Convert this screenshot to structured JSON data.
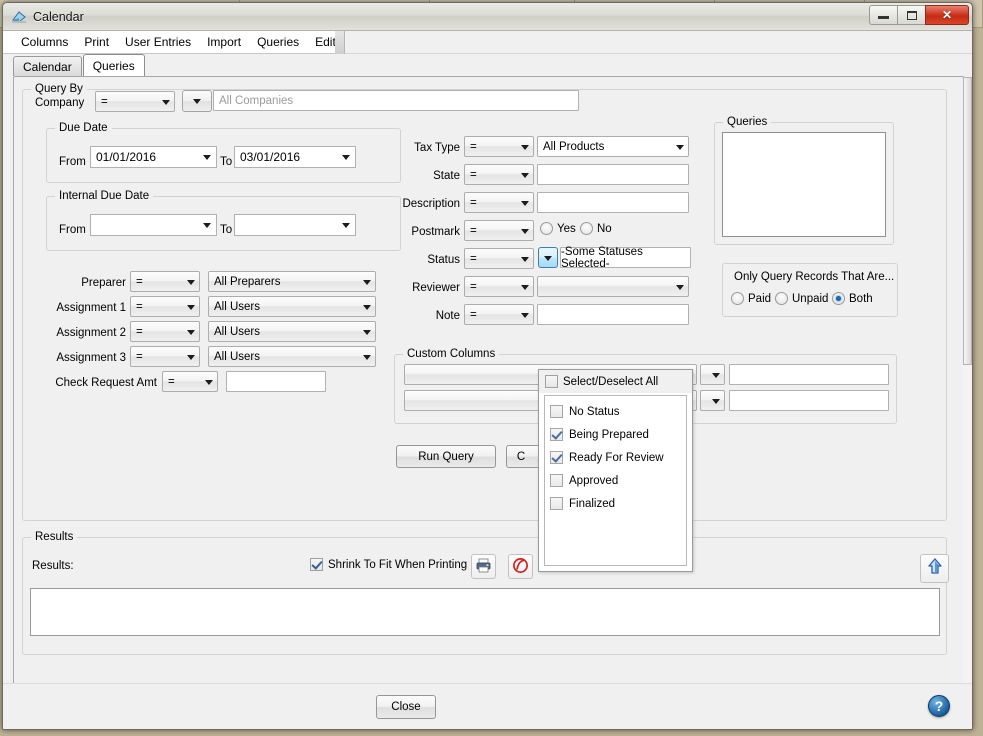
{
  "window": {
    "title": "Calendar",
    "icon": "calendar-app-icon",
    "buttons": {
      "minimize": "minimize",
      "maximize": "maximize",
      "close": "close"
    }
  },
  "menubar": {
    "items": [
      "Columns",
      "Print",
      "User Entries",
      "Import",
      "Queries",
      "Edit"
    ]
  },
  "tabs": [
    {
      "label": "Calendar",
      "active": false
    },
    {
      "label": "Queries",
      "active": true
    }
  ],
  "query_by": {
    "legend": "Query By",
    "company": {
      "label": "Company",
      "operator": "=",
      "value_placeholder": "All Companies"
    },
    "due_date": {
      "legend": "Due Date",
      "from_label": "From",
      "from_value": "01/01/2016",
      "to_label": "To",
      "to_value": "03/01/2016"
    },
    "internal_due_date": {
      "legend": "Internal Due Date",
      "from_label": "From",
      "from_value": "",
      "to_label": "To",
      "to_value": ""
    },
    "rows_left": [
      {
        "label": "Preparer",
        "operator": "=",
        "value": "All Preparers"
      },
      {
        "label": "Assignment 1",
        "operator": "=",
        "value": "All Users"
      },
      {
        "label": "Assignment 2",
        "operator": "=",
        "value": "All Users"
      },
      {
        "label": "Assignment 3",
        "operator": "=",
        "value": "All Users"
      }
    ],
    "check_request": {
      "label": "Check Request Amt",
      "operator": "=",
      "value": ""
    },
    "rows_mid": [
      {
        "label": "Tax Type",
        "operator": "=",
        "value": "All Products"
      },
      {
        "label": "State",
        "operator": "=",
        "value": ""
      },
      {
        "label": "Description",
        "operator": "=",
        "value": ""
      },
      {
        "label": "Postmark",
        "operator": "=",
        "value": ""
      },
      {
        "label": "Status",
        "operator": "=",
        "value": "-Some Statuses Selected-"
      },
      {
        "label": "Reviewer",
        "operator": "=",
        "value": ""
      },
      {
        "label": "Note",
        "operator": "=",
        "value": ""
      }
    ],
    "postmark": {
      "yes_label": "Yes",
      "no_label": "No",
      "selected": ""
    },
    "custom_columns": {
      "legend": "Custom Columns",
      "rows": [
        {
          "name": "",
          "operator": "",
          "value": ""
        },
        {
          "name": "",
          "operator": "",
          "value": ""
        }
      ]
    },
    "buttons": {
      "run_query": "Run Query",
      "secondary": "C"
    }
  },
  "queries_panel": {
    "legend": "Queries",
    "items": []
  },
  "only_query": {
    "title": "Only Query Records That Are...",
    "options": [
      {
        "label": "Paid",
        "selected": false
      },
      {
        "label": "Unpaid",
        "selected": false
      },
      {
        "label": "Both",
        "selected": true
      }
    ]
  },
  "status_dropdown": {
    "select_all_label": "Select/Deselect All",
    "select_all_checked": false,
    "items": [
      {
        "label": "No Status",
        "checked": false
      },
      {
        "label": "Being Prepared",
        "checked": true
      },
      {
        "label": "Ready For Review",
        "checked": true
      },
      {
        "label": "Approved",
        "checked": false
      },
      {
        "label": "Finalized",
        "checked": false
      }
    ]
  },
  "results": {
    "legend": "Results",
    "label": "Results:",
    "shrink_to_fit": {
      "label": "Shrink To Fit When Printing",
      "checked": true
    },
    "print_icon": "printer-icon",
    "pdf_icon": "pdf-export-icon",
    "export_icon": "upload-arrow-icon",
    "content": ""
  },
  "footer": {
    "close_label": "Close",
    "help_label": "?"
  },
  "colors": {
    "accent_blue": "#1569b5",
    "close_red": "#c62b14",
    "panel_bg": "#f0f0f0",
    "desktop": "#bdb196"
  }
}
